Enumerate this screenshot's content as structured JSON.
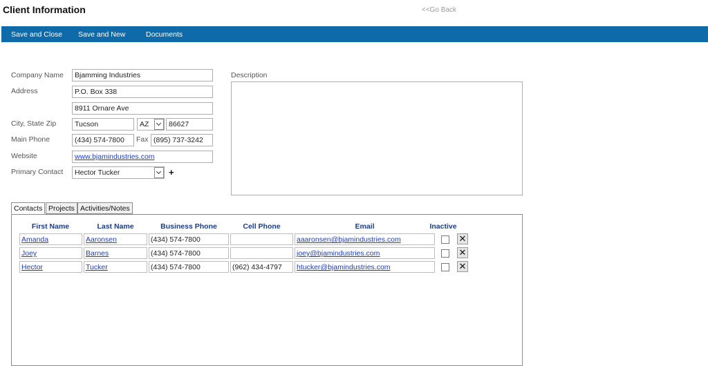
{
  "header": {
    "title": "Client Information",
    "go_back": "<<Go Back"
  },
  "toolbar": {
    "save_close": "Save and Close",
    "save_new": "Save and New",
    "documents": "Documents"
  },
  "form": {
    "company_name_label": "Company Name",
    "company_name": "Bjamming Industries",
    "address_label": "Address",
    "address1": "P.O. Box 338",
    "address2": "8911 Ornare Ave",
    "city_state_zip_label": "City, State Zip",
    "city": "Tucson",
    "state": "AZ",
    "zip": "86627",
    "main_phone_label": "Main Phone",
    "main_phone": "(434) 574-7800",
    "fax_label": "Fax",
    "fax": "(895) 737-3242",
    "website_label": "Website",
    "website": "www.bjamindustries.com",
    "primary_contact_label": "Primary Contact",
    "primary_contact": "Hector Tucker",
    "description_label": "Description"
  },
  "tabs": [
    "Contacts",
    "Projects",
    "Activities/Notes"
  ],
  "contacts": {
    "columns": [
      "First Name",
      "Last Name",
      "Business Phone",
      "Cell Phone",
      "Email",
      "Inactive"
    ],
    "rows": [
      {
        "first": "Amanda",
        "last": "Aaronsen",
        "business_phone": "(434) 574-7800",
        "cell_phone": "",
        "email": "aaaronsen@bjamindustries.com",
        "inactive": false
      },
      {
        "first": "Joey",
        "last": "Barnes",
        "business_phone": "(434) 574-7800",
        "cell_phone": "",
        "email": "joey@bjamindustries.com",
        "inactive": false
      },
      {
        "first": "Hector",
        "last": "Tucker",
        "business_phone": "(434) 574-7800",
        "cell_phone": "(962) 434-4797",
        "email": "htucker@bjamindustries.com",
        "inactive": false
      }
    ]
  },
  "icons": {
    "add_contact": "plus-icon",
    "delete_row": "close-icon",
    "dropdown": "chevron-down-icon"
  },
  "colors": {
    "toolbar_bg": "#0e6aa8",
    "link": "#1a3cc8",
    "column_header": "#1a3a8c"
  }
}
